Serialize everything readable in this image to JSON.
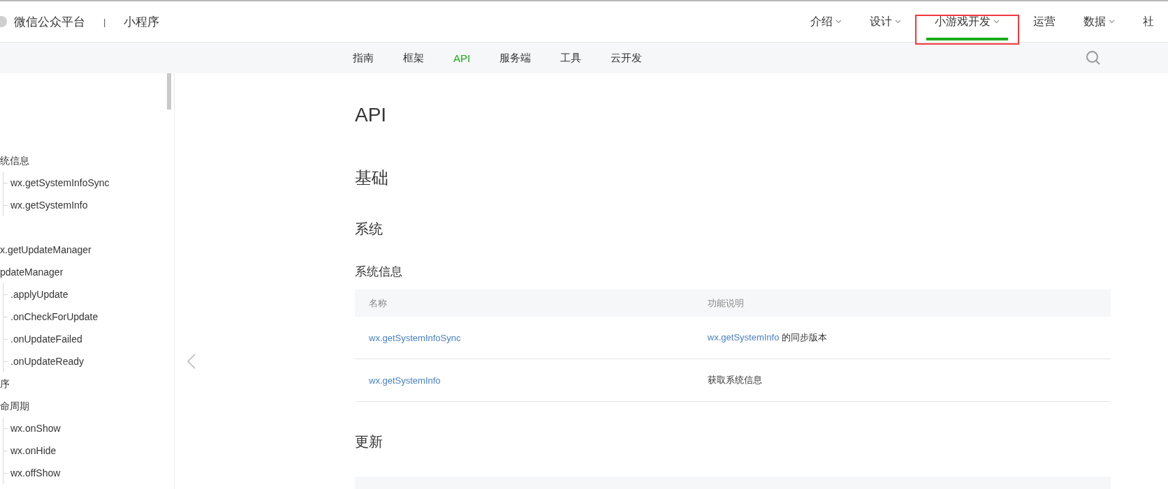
{
  "header": {
    "brand": "微信公众平台",
    "separator": "|",
    "product": "小程序",
    "nav": [
      {
        "label": "介绍",
        "selected": false,
        "has_menu": true,
        "annotated": false
      },
      {
        "label": "设计",
        "selected": false,
        "has_menu": true,
        "annotated": false
      },
      {
        "label": "小游戏开发",
        "selected": true,
        "has_menu": true,
        "annotated": true
      },
      {
        "label": "运营",
        "selected": false,
        "has_menu": false,
        "annotated": false
      },
      {
        "label": "数据",
        "selected": false,
        "has_menu": true,
        "annotated": false
      },
      {
        "label": "社",
        "selected": false,
        "has_menu": false,
        "annotated": false
      }
    ]
  },
  "subnav": {
    "tabs": [
      {
        "label": "指南",
        "selected": false
      },
      {
        "label": "框架",
        "selected": false
      },
      {
        "label": "API",
        "selected": true
      },
      {
        "label": "服务端",
        "selected": false
      },
      {
        "label": "工具",
        "selected": false
      },
      {
        "label": "云开发",
        "selected": false
      }
    ]
  },
  "sidebar": {
    "groups": [
      {
        "items": [
          {
            "label": "统信息",
            "children": [
              {
                "label": "wx.getSystemInfoSync"
              },
              {
                "label": "wx.getSystemInfo"
              }
            ]
          }
        ]
      },
      {
        "items": [
          {
            "label": "x.getUpdateManager"
          },
          {
            "label": "pdateManager",
            "children": [
              {
                "label": ".applyUpdate"
              },
              {
                "label": ".onCheckForUpdate"
              },
              {
                "label": ".onUpdateFailed"
              },
              {
                "label": ".onUpdateReady"
              }
            ]
          },
          {
            "label": "序"
          },
          {
            "label": "命周期",
            "children": [
              {
                "label": "wx.onShow"
              },
              {
                "label": "wx.onHide"
              },
              {
                "label": "wx.offShow"
              }
            ]
          }
        ]
      }
    ]
  },
  "content": [
    {
      "kind": "h1",
      "text": "API"
    },
    {
      "kind": "h2",
      "text": "基础"
    },
    {
      "kind": "h3",
      "text": "系统"
    },
    {
      "kind": "h4",
      "text": "系统信息"
    },
    {
      "kind": "table",
      "columns": [
        "名称",
        "功能说明"
      ],
      "rows": [
        {
          "name": "wx.getSystemInfoSync",
          "description": [
            {
              "kind": "link",
              "text": "wx.getSystemInfo"
            },
            {
              "kind": "text",
              "text": " 的同步版本"
            }
          ]
        },
        {
          "name": "wx.getSystemInfo",
          "description": [
            {
              "kind": "text",
              "text": "获取系统信息"
            }
          ]
        }
      ]
    },
    {
      "kind": "h3",
      "text": "更新"
    },
    {
      "kind": "table_stub"
    }
  ]
}
